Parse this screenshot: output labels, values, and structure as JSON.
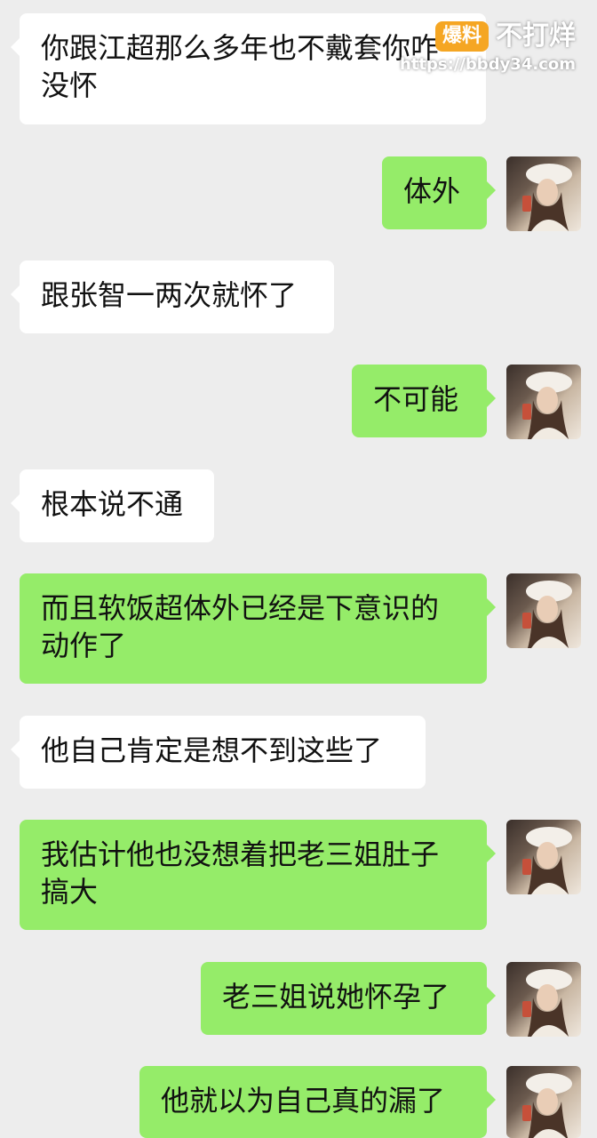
{
  "messages": [
    {
      "side": "in",
      "text": "你跟江超那么多年也不戴套你咋\n没怀"
    },
    {
      "side": "out",
      "text": "体外"
    },
    {
      "side": "in",
      "text": "跟张智一两次就怀了"
    },
    {
      "side": "out",
      "text": "不可能"
    },
    {
      "side": "in",
      "text": "根本说不通"
    },
    {
      "side": "out",
      "text": "而且软饭超体外已经是下意识的\n动作了"
    },
    {
      "side": "in",
      "text": "他自己肯定是想不到这些了"
    },
    {
      "side": "out",
      "text": "我估计他也没想着把老三姐肚子\n搞大"
    },
    {
      "side": "out",
      "text": "老三姐说她怀孕了"
    },
    {
      "side": "out",
      "text": "他就以为自己真的漏了"
    }
  ],
  "watermark": {
    "badge": "爆料",
    "brand": "不打烊",
    "url": "https://bbdy34.com"
  },
  "colors": {
    "background": "#ededed",
    "incoming_bubble": "#ffffff",
    "outgoing_bubble": "#95ec69",
    "watermark_badge": "#f5a623"
  },
  "icons": {
    "avatar": "user-avatar-photo"
  }
}
